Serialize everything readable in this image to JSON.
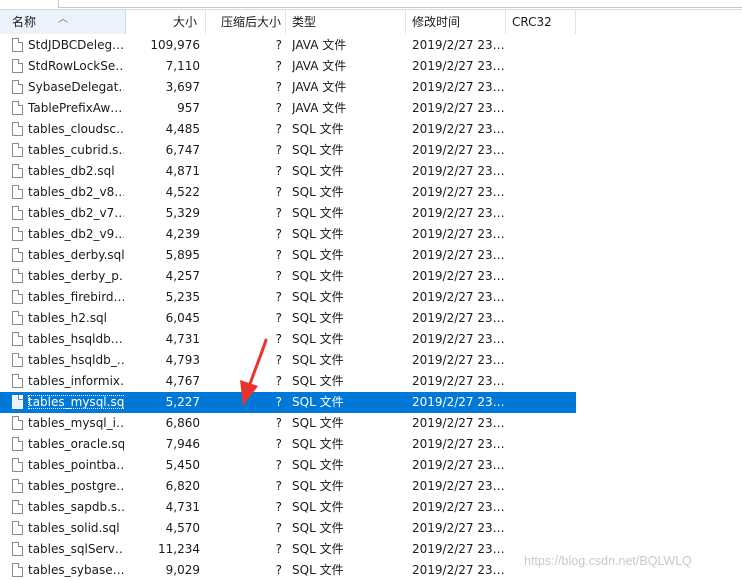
{
  "window": {
    "path_text": "…………"
  },
  "columns": {
    "name": "名称",
    "size": "大小",
    "packed": "压缩后大小",
    "type": "类型",
    "modified": "修改时间",
    "crc": "CRC32"
  },
  "files": [
    {
      "name": "StdJDBCDeleg…",
      "size": "109,976",
      "packed": "?",
      "type": "JAVA 文件",
      "modified": "2019/2/27 23…",
      "crc": ""
    },
    {
      "name": "StdRowLockSe…",
      "size": "7,110",
      "packed": "?",
      "type": "JAVA 文件",
      "modified": "2019/2/27 23…",
      "crc": ""
    },
    {
      "name": "SybaseDelegat…",
      "size": "3,697",
      "packed": "?",
      "type": "JAVA 文件",
      "modified": "2019/2/27 23…",
      "crc": ""
    },
    {
      "name": "TablePrefixAw…",
      "size": "957",
      "packed": "?",
      "type": "JAVA 文件",
      "modified": "2019/2/27 23…",
      "crc": ""
    },
    {
      "name": "tables_cloudsc…",
      "size": "4,485",
      "packed": "?",
      "type": "SQL 文件",
      "modified": "2019/2/27 23…",
      "crc": ""
    },
    {
      "name": "tables_cubrid.s…",
      "size": "6,747",
      "packed": "?",
      "type": "SQL 文件",
      "modified": "2019/2/27 23…",
      "crc": ""
    },
    {
      "name": "tables_db2.sql",
      "size": "4,871",
      "packed": "?",
      "type": "SQL 文件",
      "modified": "2019/2/27 23…",
      "crc": ""
    },
    {
      "name": "tables_db2_v8…",
      "size": "4,522",
      "packed": "?",
      "type": "SQL 文件",
      "modified": "2019/2/27 23…",
      "crc": ""
    },
    {
      "name": "tables_db2_v7…",
      "size": "5,329",
      "packed": "?",
      "type": "SQL 文件",
      "modified": "2019/2/27 23…",
      "crc": ""
    },
    {
      "name": "tables_db2_v9…",
      "size": "4,239",
      "packed": "?",
      "type": "SQL 文件",
      "modified": "2019/2/27 23…",
      "crc": ""
    },
    {
      "name": "tables_derby.sql",
      "size": "5,895",
      "packed": "?",
      "type": "SQL 文件",
      "modified": "2019/2/27 23…",
      "crc": ""
    },
    {
      "name": "tables_derby_p…",
      "size": "4,257",
      "packed": "?",
      "type": "SQL 文件",
      "modified": "2019/2/27 23…",
      "crc": ""
    },
    {
      "name": "tables_firebird…",
      "size": "5,235",
      "packed": "?",
      "type": "SQL 文件",
      "modified": "2019/2/27 23…",
      "crc": ""
    },
    {
      "name": "tables_h2.sql",
      "size": "6,045",
      "packed": "?",
      "type": "SQL 文件",
      "modified": "2019/2/27 23…",
      "crc": ""
    },
    {
      "name": "tables_hsqldb…",
      "size": "4,731",
      "packed": "?",
      "type": "SQL 文件",
      "modified": "2019/2/27 23…",
      "crc": ""
    },
    {
      "name": "tables_hsqldb_…",
      "size": "4,793",
      "packed": "?",
      "type": "SQL 文件",
      "modified": "2019/2/27 23…",
      "crc": ""
    },
    {
      "name": "tables_informix…",
      "size": "4,767",
      "packed": "?",
      "type": "SQL 文件",
      "modified": "2019/2/27 23…",
      "crc": ""
    },
    {
      "name": "tables_mysql.sql",
      "size": "5,227",
      "packed": "?",
      "type": "SQL 文件",
      "modified": "2019/2/27 23…",
      "crc": "",
      "selected": true
    },
    {
      "name": "tables_mysql_i…",
      "size": "6,860",
      "packed": "?",
      "type": "SQL 文件",
      "modified": "2019/2/27 23…",
      "crc": ""
    },
    {
      "name": "tables_oracle.sql",
      "size": "7,946",
      "packed": "?",
      "type": "SQL 文件",
      "modified": "2019/2/27 23…",
      "crc": ""
    },
    {
      "name": "tables_pointba…",
      "size": "5,450",
      "packed": "?",
      "type": "SQL 文件",
      "modified": "2019/2/27 23…",
      "crc": ""
    },
    {
      "name": "tables_postgre…",
      "size": "6,820",
      "packed": "?",
      "type": "SQL 文件",
      "modified": "2019/2/27 23…",
      "crc": ""
    },
    {
      "name": "tables_sapdb.s…",
      "size": "4,731",
      "packed": "?",
      "type": "SQL 文件",
      "modified": "2019/2/27 23…",
      "crc": ""
    },
    {
      "name": "tables_solid.sql",
      "size": "4,570",
      "packed": "?",
      "type": "SQL 文件",
      "modified": "2019/2/27 23…",
      "crc": ""
    },
    {
      "name": "tables_sqlServ…",
      "size": "11,234",
      "packed": "?",
      "type": "SQL 文件",
      "modified": "2019/2/27 23…",
      "crc": ""
    },
    {
      "name": "tables_sybase…",
      "size": "9,029",
      "packed": "?",
      "type": "SQL 文件",
      "modified": "2019/2/27 23…",
      "crc": ""
    }
  ],
  "colors": {
    "selection": "#0078d7",
    "annotation_arrow": "#e8352b",
    "sorted_header_bg": "#eaf3fc"
  },
  "icons": {
    "file": "file-icon",
    "sort": "sort-ascending-icon"
  },
  "watermark": "https://blog.csdn.net/BQLWLQ"
}
